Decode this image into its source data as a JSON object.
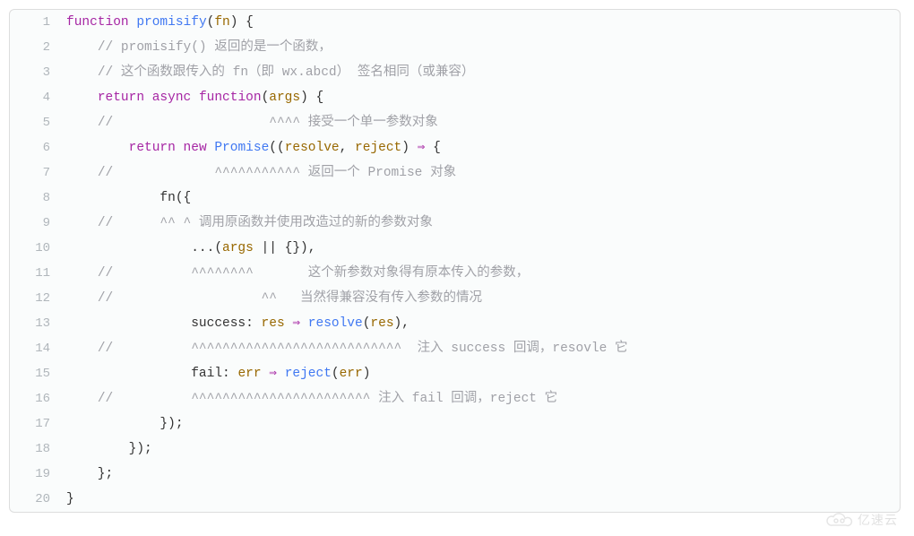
{
  "watermark": "亿速云",
  "lines": [
    {
      "n": "1",
      "segs": [
        {
          "c": "kw",
          "t": "function"
        },
        {
          "c": "op",
          "t": " "
        },
        {
          "c": "fn",
          "t": "promisify"
        },
        {
          "c": "paren",
          "t": "("
        },
        {
          "c": "prm",
          "t": "fn"
        },
        {
          "c": "paren",
          "t": ")"
        },
        {
          "c": "op",
          "t": " {"
        }
      ]
    },
    {
      "n": "2",
      "segs": [
        {
          "c": "op",
          "t": "    "
        },
        {
          "c": "cmt",
          "t": "// promisify() 返回的是一个函数，"
        }
      ]
    },
    {
      "n": "3",
      "segs": [
        {
          "c": "op",
          "t": "    "
        },
        {
          "c": "cmt",
          "t": "// 这个函数跟传入的 fn（即 wx.abcd） 签名相同（或兼容）"
        }
      ]
    },
    {
      "n": "4",
      "segs": [
        {
          "c": "op",
          "t": "    "
        },
        {
          "c": "kw",
          "t": "return"
        },
        {
          "c": "op",
          "t": " "
        },
        {
          "c": "kw",
          "t": "async"
        },
        {
          "c": "op",
          "t": " "
        },
        {
          "c": "kw",
          "t": "function"
        },
        {
          "c": "paren",
          "t": "("
        },
        {
          "c": "prm",
          "t": "args"
        },
        {
          "c": "paren",
          "t": ")"
        },
        {
          "c": "op",
          "t": " {"
        }
      ]
    },
    {
      "n": "5",
      "segs": [
        {
          "c": "op",
          "t": "    "
        },
        {
          "c": "cmt",
          "t": "//                    ^^^^ 接受一个单一参数对象"
        }
      ]
    },
    {
      "n": "6",
      "segs": [
        {
          "c": "op",
          "t": "        "
        },
        {
          "c": "kw",
          "t": "return"
        },
        {
          "c": "op",
          "t": " "
        },
        {
          "c": "kw",
          "t": "new"
        },
        {
          "c": "op",
          "t": " "
        },
        {
          "c": "fn",
          "t": "Promise"
        },
        {
          "c": "paren",
          "t": "(("
        },
        {
          "c": "prm",
          "t": "resolve"
        },
        {
          "c": "op",
          "t": ", "
        },
        {
          "c": "prm",
          "t": "reject"
        },
        {
          "c": "paren",
          "t": ")"
        },
        {
          "c": "op",
          "t": " "
        },
        {
          "c": "arrow",
          "t": "⇒"
        },
        {
          "c": "op",
          "t": " {"
        }
      ]
    },
    {
      "n": "7",
      "segs": [
        {
          "c": "op",
          "t": "    "
        },
        {
          "c": "cmt",
          "t": "//             ^^^^^^^^^^^ 返回一个 Promise 对象"
        }
      ]
    },
    {
      "n": "8",
      "segs": [
        {
          "c": "op",
          "t": "            "
        },
        {
          "c": "prop",
          "t": "fn"
        },
        {
          "c": "paren",
          "t": "({"
        }
      ]
    },
    {
      "n": "9",
      "segs": [
        {
          "c": "op",
          "t": "    "
        },
        {
          "c": "cmt",
          "t": "//      ^^ ^ 调用原函数并使用改造过的新的参数对象"
        }
      ]
    },
    {
      "n": "10",
      "segs": [
        {
          "c": "op",
          "t": "                ...("
        },
        {
          "c": "prm",
          "t": "args"
        },
        {
          "c": "op",
          "t": " || {}),"
        }
      ]
    },
    {
      "n": "11",
      "segs": [
        {
          "c": "op",
          "t": "    "
        },
        {
          "c": "cmt",
          "t": "//          ^^^^^^^^       这个新参数对象得有原本传入的参数，"
        }
      ]
    },
    {
      "n": "12",
      "segs": [
        {
          "c": "op",
          "t": "    "
        },
        {
          "c": "cmt",
          "t": "//                   ^^   当然得兼容没有传入参数的情况"
        }
      ]
    },
    {
      "n": "13",
      "segs": [
        {
          "c": "op",
          "t": "                success: "
        },
        {
          "c": "prm",
          "t": "res"
        },
        {
          "c": "op",
          "t": " "
        },
        {
          "c": "arrow",
          "t": "⇒"
        },
        {
          "c": "op",
          "t": " "
        },
        {
          "c": "fn",
          "t": "resolve"
        },
        {
          "c": "paren",
          "t": "("
        },
        {
          "c": "prm",
          "t": "res"
        },
        {
          "c": "paren",
          "t": ")"
        },
        {
          "c": "op",
          "t": ","
        }
      ]
    },
    {
      "n": "14",
      "segs": [
        {
          "c": "op",
          "t": "    "
        },
        {
          "c": "cmt",
          "t": "//          ^^^^^^^^^^^^^^^^^^^^^^^^^^^  注入 success 回调，resovle 它"
        }
      ]
    },
    {
      "n": "15",
      "segs": [
        {
          "c": "op",
          "t": "                fail: "
        },
        {
          "c": "prm",
          "t": "err"
        },
        {
          "c": "op",
          "t": " "
        },
        {
          "c": "arrow",
          "t": "⇒"
        },
        {
          "c": "op",
          "t": " "
        },
        {
          "c": "fn",
          "t": "reject"
        },
        {
          "c": "paren",
          "t": "("
        },
        {
          "c": "prm",
          "t": "err"
        },
        {
          "c": "paren",
          "t": ")"
        }
      ]
    },
    {
      "n": "16",
      "segs": [
        {
          "c": "op",
          "t": "    "
        },
        {
          "c": "cmt",
          "t": "//          ^^^^^^^^^^^^^^^^^^^^^^^ 注入 fail 回调，reject 它"
        }
      ]
    },
    {
      "n": "17",
      "segs": [
        {
          "c": "op",
          "t": "            });"
        }
      ]
    },
    {
      "n": "18",
      "segs": [
        {
          "c": "op",
          "t": "        });"
        }
      ]
    },
    {
      "n": "19",
      "segs": [
        {
          "c": "op",
          "t": "    };"
        }
      ]
    },
    {
      "n": "20",
      "segs": [
        {
          "c": "op",
          "t": "}"
        }
      ]
    }
  ]
}
